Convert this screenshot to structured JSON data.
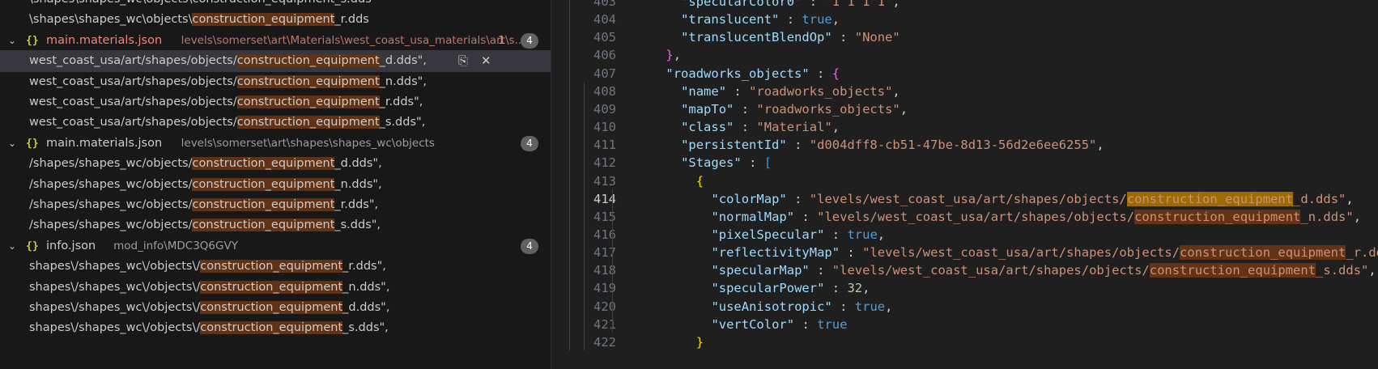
{
  "search_results": {
    "top_partial": "\\shapes\\shapes_wc\\objects\\construction_equipment_s.dds",
    "top_line": {
      "pre": "\\shapes\\shapes_wc\\objects\\",
      "match": "construction_equipment",
      "post": "_r.dds"
    },
    "files": [
      {
        "name": "main.materials.json",
        "path": "levels\\somerset\\art\\Materials\\west_coast_usa_materials\\art\\s...",
        "problems": "1",
        "count": "4",
        "matches": [
          {
            "pre": "west_coast_usa/art/shapes/objects/",
            "match": "construction_equipment",
            "post": "_d.dds\","
          },
          {
            "pre": "west_coast_usa/art/shapes/objects/",
            "match": "construction_equipment",
            "post": "_n.dds\","
          },
          {
            "pre": "west_coast_usa/art/shapes/objects/",
            "match": "construction_equipment",
            "post": "_r.dds\","
          },
          {
            "pre": "west_coast_usa/art/shapes/objects/",
            "match": "construction_equipment",
            "post": "_s.dds\","
          }
        ]
      },
      {
        "name": "main.materials.json",
        "path": "levels\\somerset\\art\\shapes\\shapes_wc\\objects",
        "count": "4",
        "matches": [
          {
            "pre": "/shapes/shapes_wc/objects/",
            "match": "construction_equipment",
            "post": "_d.dds\","
          },
          {
            "pre": "/shapes/shapes_wc/objects/",
            "match": "construction_equipment",
            "post": "_n.dds\","
          },
          {
            "pre": "/shapes/shapes_wc/objects/",
            "match": "construction_equipment",
            "post": "_r.dds\","
          },
          {
            "pre": "/shapes/shapes_wc/objects/",
            "match": "construction_equipment",
            "post": "_s.dds\","
          }
        ]
      },
      {
        "name": "info.json",
        "path": "mod_info\\MDC3Q6GVY",
        "count": "4",
        "matches": [
          {
            "pre": "shapes\\/shapes_wc\\/objects\\/",
            "match": "construction_equipment",
            "post": "_r.dds\","
          },
          {
            "pre": "shapes\\/shapes_wc\\/objects\\/",
            "match": "construction_equipment",
            "post": "_n.dds\","
          },
          {
            "pre": "shapes\\/shapes_wc\\/objects\\/",
            "match": "construction_equipment",
            "post": "_d.dds\","
          },
          {
            "pre": "shapes\\/shapes_wc\\/objects\\/",
            "match": "construction_equipment",
            "post": "_s.dds\","
          }
        ]
      }
    ],
    "icons": {
      "collapse": "chevron-down-icon",
      "file": "json-file-icon",
      "replace": "replace-icon",
      "dismiss": "close-icon"
    },
    "glyphs": {
      "chevron": "⌄",
      "json": "{}",
      "replace": "⎘",
      "dismiss": "✕"
    }
  },
  "editor": {
    "current_line": "414",
    "lines": [
      {
        "num": "403",
        "code": "      \"specularColor0\" : \"1 1 1 1\","
      },
      {
        "num": "404",
        "code": "      \"translucent\" : true,"
      },
      {
        "num": "405",
        "code": "      \"translucentBlendOp\" : \"None\""
      },
      {
        "num": "406",
        "code": "    },"
      },
      {
        "num": "407",
        "code": "    \"roadworks_objects\" : {"
      },
      {
        "num": "408",
        "code": "      \"name\" : \"roadworks_objects\","
      },
      {
        "num": "409",
        "code": "      \"mapTo\" : \"roadworks_objects\","
      },
      {
        "num": "410",
        "code": "      \"class\" : \"Material\","
      },
      {
        "num": "411",
        "code": "      \"persistentId\" : \"d004dff8-cb51-47be-8d13-56d2e6ee6255\","
      },
      {
        "num": "412",
        "code": "      \"Stages\" : ["
      },
      {
        "num": "413",
        "code": "        {"
      },
      {
        "num": "414",
        "code": "          \"colorMap\" : \"levels/west_coast_usa/art/shapes/objects/construction_equipment_d.dds\","
      },
      {
        "num": "415",
        "code": "          \"normalMap\" : \"levels/west_coast_usa/art/shapes/objects/construction_equipment_n.dds\","
      },
      {
        "num": "416",
        "code": "          \"pixelSpecular\" : true,"
      },
      {
        "num": "417",
        "code": "          \"reflectivityMap\" : \"levels/west_coast_usa/art/shapes/objects/construction_equipment_r.dds\","
      },
      {
        "num": "418",
        "code": "          \"specularMap\" : \"levels/west_coast_usa/art/shapes/objects/construction_equipment_s.dds\","
      },
      {
        "num": "419",
        "code": "          \"specularPower\" : 32,"
      },
      {
        "num": "420",
        "code": "          \"useAnisotropic\" : true,"
      },
      {
        "num": "421",
        "code": "          \"vertColor\" : true"
      },
      {
        "num": "422",
        "code": "        }"
      }
    ]
  },
  "search_term": "construction_equipment",
  "colors": {
    "match_highlight": "#613214",
    "current_match": "#9e6a03",
    "error": "#f48771",
    "json_icon": "#cbcb41"
  }
}
